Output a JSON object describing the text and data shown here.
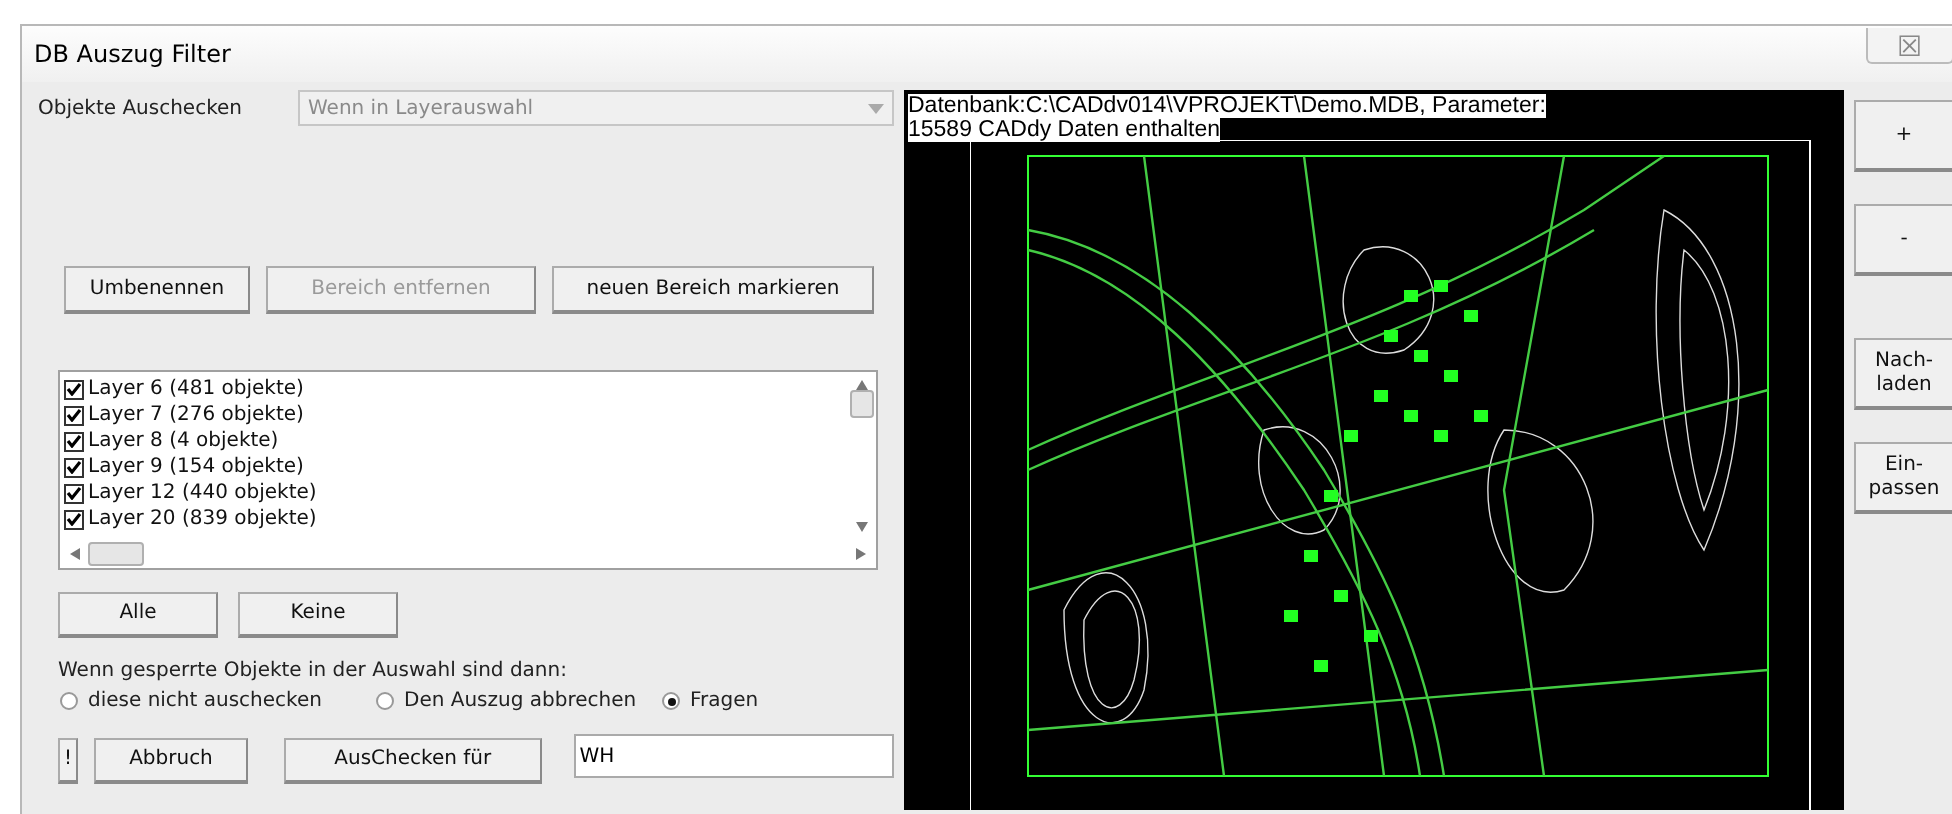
{
  "window": {
    "title": "DB Auszug Filter",
    "close": "☒"
  },
  "checkout": {
    "label": "Objekte Auschecken",
    "value": "Wenn in Layerauswahl",
    "disabled": true
  },
  "area_buttons": [
    {
      "label": "Umbenennen",
      "disabled": false
    },
    {
      "label": "Bereich entfernen",
      "disabled": true
    },
    {
      "label": "neuen Bereich markieren",
      "disabled": false
    }
  ],
  "layers": [
    {
      "label": "Layer 6 (481 objekte)",
      "checked": true
    },
    {
      "label": "Layer 7 (276 objekte)",
      "checked": true
    },
    {
      "label": "Layer 8 (4 objekte)",
      "checked": true
    },
    {
      "label": "Layer 9 (154 objekte)",
      "checked": true
    },
    {
      "label": "Layer 12 (440 objekte)",
      "checked": true
    },
    {
      "label": "Layer 20 (839 objekte)",
      "checked": true
    }
  ],
  "list_buttons": [
    "Alle",
    "Keine"
  ],
  "locked": {
    "question": "Wenn gesperrte Objekte in der Auswahl sind dann:",
    "options": [
      {
        "label": "diese nicht auschecken",
        "selected": false
      },
      {
        "label": "Den Auszug abbrechen",
        "selected": false
      },
      {
        "label": "Fragen",
        "selected": true
      }
    ]
  },
  "bottom": {
    "bang": "!",
    "cancel": "Abbruch",
    "checkout": "AusChecken für",
    "user": "WH"
  },
  "preview": {
    "info_lines": [
      "Datenbank:C:\\CADdv014\\VPROJEKT\\Demo.MDB, Parameter:",
      "15589 CADdy Daten enthalten"
    ]
  },
  "side_buttons": [
    {
      "label": "+"
    },
    {
      "label": "-"
    },
    {
      "label": "Nach-\nladen"
    },
    {
      "label": "Ein-\npassen"
    }
  ]
}
